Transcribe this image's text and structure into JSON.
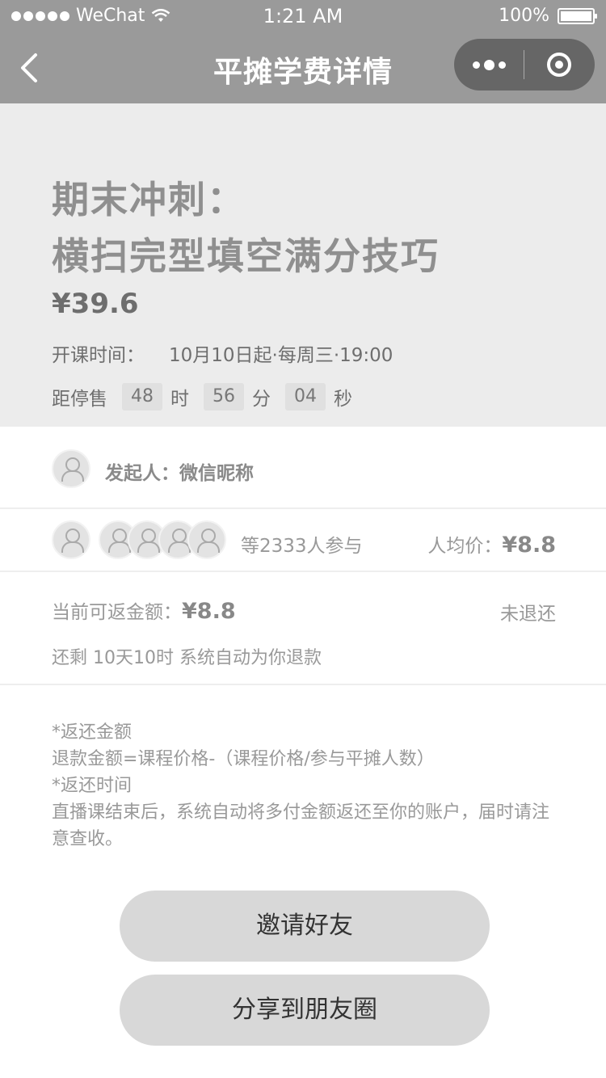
{
  "status_bar": {
    "carrier": "WeChat",
    "time": "1:21 AM",
    "battery": "100%"
  },
  "nav": {
    "title": "平摊学费详情"
  },
  "course": {
    "title_line1": "期末冲刺：",
    "title_line2": "横扫完型填空满分技巧",
    "price": "¥39.6",
    "start_label": "开课时间：",
    "start_value": "10月10日起·每周三·19:00",
    "countdown_label": "距停售",
    "hours": "48",
    "hours_unit": "时",
    "minutes": "56",
    "minutes_unit": "分",
    "seconds": "04",
    "seconds_unit": "秒"
  },
  "initiator": {
    "label": "发起人：微信昵称"
  },
  "participants": {
    "text": "等2333人参与",
    "avg_label": "人均价：",
    "avg_value": "¥8.8"
  },
  "refund": {
    "amount_label": "当前可返金额：",
    "amount_value": "¥8.8",
    "status": "未退还",
    "remain": "还剩 10天10时 系统自动为你退款"
  },
  "notes": {
    "line1": "*返还金额",
    "line2": "退款金额=课程价格-（课程价格/参与平摊人数）",
    "line3": "*返还时间",
    "line4": "直播课结束后，系统自动将多付金额返还至你的账户，届时请注意查收。"
  },
  "buttons": {
    "invite": "邀请好友",
    "share": "分享到朋友圈"
  }
}
